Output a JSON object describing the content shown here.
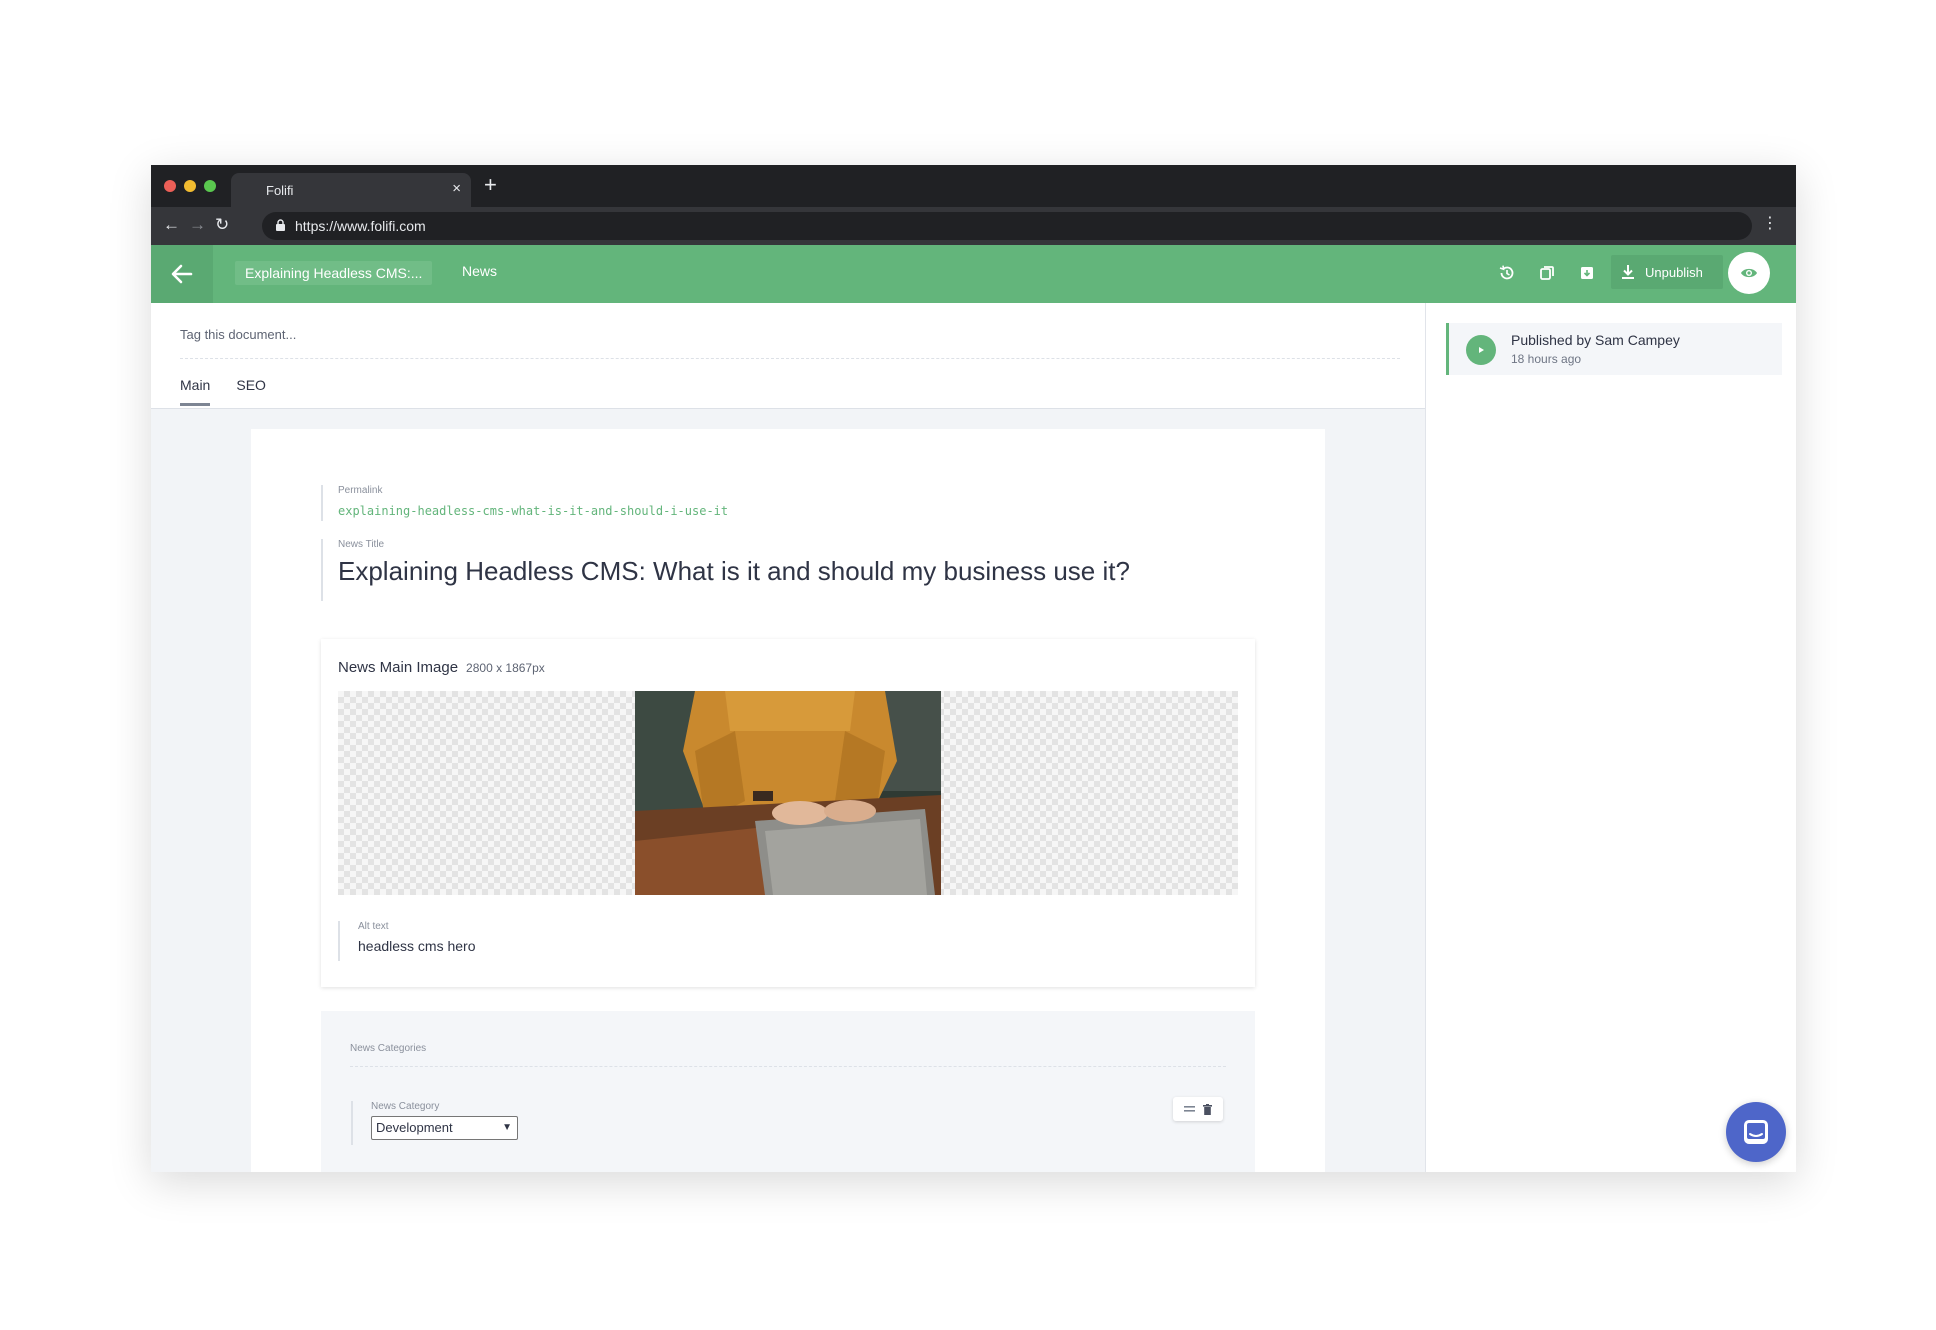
{
  "browser": {
    "tab_title": "Folifi",
    "tab_close": "×",
    "new_tab": "+",
    "url": "https://www.folifi.com",
    "menu": "⋮",
    "back": "←",
    "forward": "→",
    "reload": "↻"
  },
  "header": {
    "document_title": "Explaining Headless CMS:...",
    "breadcrumb": "News",
    "unpublish_label": "Unpublish",
    "icons": [
      "history-icon",
      "duplicate-icon",
      "archive-icon",
      "download-icon",
      "eye-icon"
    ]
  },
  "document": {
    "tag_placeholder": "Tag this document...",
    "tabs": [
      {
        "label": "Main",
        "active": true
      },
      {
        "label": "SEO",
        "active": false
      }
    ],
    "permalink": {
      "label": "Permalink",
      "value": "explaining-headless-cms-what-is-it-and-should-i-use-it"
    },
    "news_title": {
      "label": "News Title",
      "value": "Explaining Headless CMS: What is it and should my business use it?"
    },
    "main_image": {
      "label": "News Main Image",
      "dimensions": "2800 x 1867px",
      "alt_label": "Alt text",
      "alt_value": "headless cms hero"
    },
    "categories": {
      "section_label": "News Categories",
      "field_label": "News Category",
      "selected": "Development"
    }
  },
  "sidebar": {
    "published_by": "Published by Sam Campey",
    "published_time": "18 hours ago"
  },
  "colors": {
    "brand_green": "#63b57b",
    "chat_blue": "#4e66c9"
  }
}
